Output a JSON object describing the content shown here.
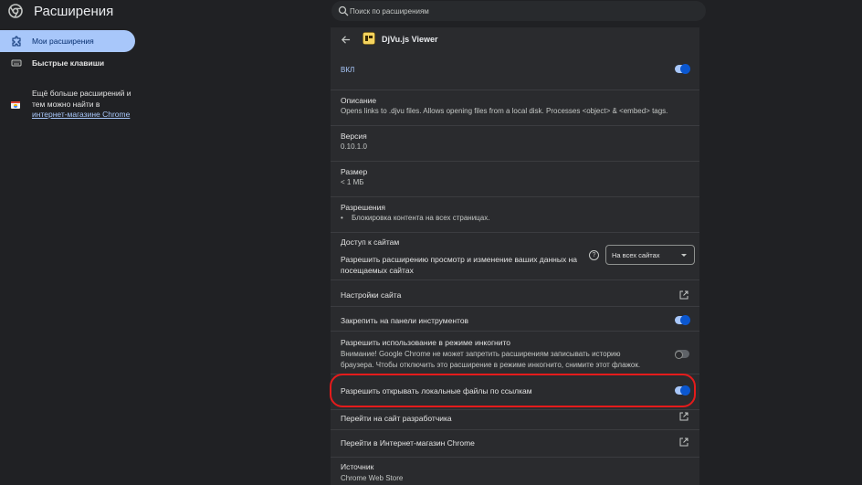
{
  "header": {
    "title": "Расширения",
    "search_placeholder": "Поиск по расширениям",
    "logo_icon": "chrome-logo-icon"
  },
  "sidebar": {
    "items": [
      {
        "label": "Мои расширения",
        "icon": "puzzle-icon",
        "active": true
      },
      {
        "label": "Быстрые клавиши",
        "icon": "keyboard-icon",
        "active": false
      }
    ],
    "promo_text": "Ещё больше расширений и тем можно найти в ",
    "promo_link": "интернет-магазине Chrome"
  },
  "details": {
    "extension_name": "DjVu.js Viewer",
    "on_label": "ВКЛ",
    "enabled": true,
    "description_title": "Описание",
    "description_text": "Opens links to .djvu files. Allows opening files from a local disk. Processes <object> & <embed> tags.",
    "version_title": "Версия",
    "version_value": "0.10.1.0",
    "size_title": "Размер",
    "size_value": "< 1 МБ",
    "permissions_title": "Разрешения",
    "permissions_items": [
      "Блокировка контента на всех страницах."
    ],
    "site_access_title": "Доступ к сайтам",
    "site_access_text": "Разрешить расширению просмотр и изменение ваших данных на посещаемых сайтах",
    "site_access_value": "На всех сайтах",
    "site_settings_label": "Настройки сайта",
    "pin_label": "Закрепить на панели инструментов",
    "pin_enabled": true,
    "incognito_title": "Разрешить использование в режиме инкогнито",
    "incognito_text": "Внимание! Google Chrome не может запретить расширениям записывать историю браузера. Чтобы отключить это расширение в режиме инкогнито, снимите этот флажок.",
    "incognito_enabled": false,
    "file_urls_label": "Разрешить открывать локальные файлы по ссылкам",
    "file_urls_enabled": true,
    "developer_site_label": "Перейти на сайт разработчика",
    "webstore_label": "Перейти в Интернет-магазин Chrome",
    "source_title": "Источник",
    "source_value": "Chrome Web Store"
  },
  "colors": {
    "accent": "#a8c7fa",
    "highlight": "#e51b1b",
    "background": "#202124",
    "panel": "#2a2b2e"
  }
}
